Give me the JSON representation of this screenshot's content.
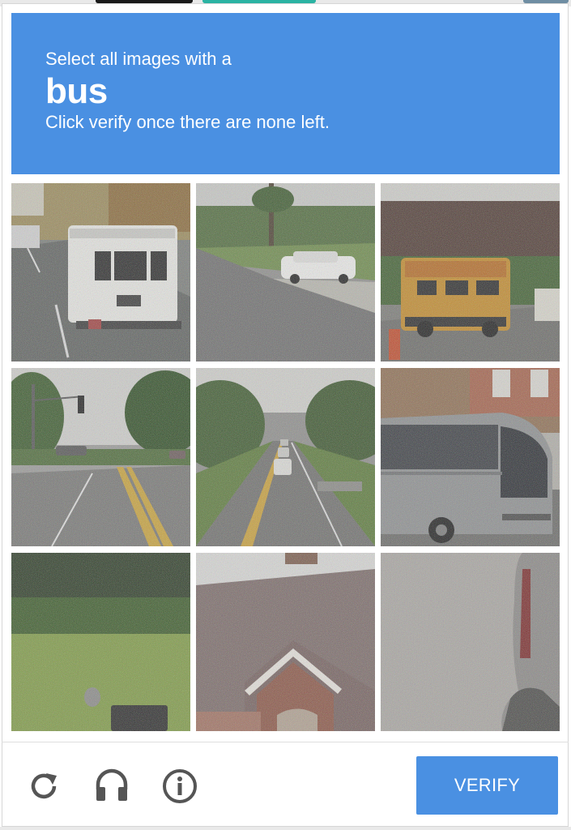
{
  "challenge": {
    "prompt_prefix": "Select all images with a",
    "keyword": "bus",
    "instruction": "Click verify once there are none left."
  },
  "tiles": [
    {
      "row": 1,
      "col": 1,
      "content": "white shuttle bus on road"
    },
    {
      "row": 1,
      "col": 2,
      "content": "road with white car"
    },
    {
      "row": 1,
      "col": 3,
      "content": "yellow school bus rear"
    },
    {
      "row": 2,
      "col": 1,
      "content": "road with traffic light"
    },
    {
      "row": 2,
      "col": 2,
      "content": "road with cars and trees"
    },
    {
      "row": 2,
      "col": 3,
      "content": "gray coach bus"
    },
    {
      "row": 3,
      "col": 1,
      "content": "grass lawn"
    },
    {
      "row": 3,
      "col": 2,
      "content": "house roof"
    },
    {
      "row": 3,
      "col": 3,
      "content": "noisy partial vehicle"
    }
  ],
  "footer": {
    "reload_icon": "reload-icon",
    "audio_icon": "headphones-icon",
    "info_icon": "info-icon",
    "verify_label": "VERIFY"
  },
  "colors": {
    "accent": "#4a90e2",
    "icon": "#555555"
  }
}
